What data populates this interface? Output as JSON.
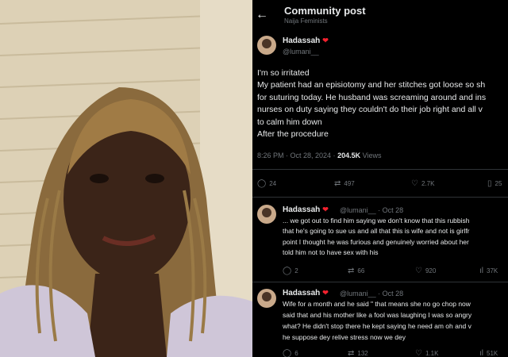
{
  "header": {
    "title": "Community post",
    "community": "Naija Feminists",
    "back_icon": "arrow-left-icon"
  },
  "main_post": {
    "name": "Hadassah",
    "handle": "@lumani__",
    "lines": [
      "I'm so irritated",
      "My patient had an episiotomy and her stitches got loose so sh",
      "for suturing today. He husband was screaming around and ins",
      "nurses on duty saying they couldn't do their job right and all v",
      "to calm him down",
      "After the procedure"
    ],
    "time": "8:26 PM · Oct 28, 2024 ·",
    "views": "204.5K",
    "views_label": "Views",
    "stats": {
      "replies": "24",
      "reposts": "497",
      "likes": "2.7K",
      "bookmarks": "25"
    }
  },
  "replies": [
    {
      "name": "Hadassah",
      "handle": "@lumani__ · Oct 28",
      "lines": [
        "... we got out to find him saying we don't know that this rubbish",
        "that he's going to sue us and all that this is wife and not is girlfr",
        "point I thought he was furious and genuinely worried about her",
        "told him not to have sex with his"
      ],
      "stats": {
        "replies": "2",
        "reposts": "66",
        "likes": "920",
        "views": "37K"
      }
    },
    {
      "name": "Hadassah",
      "handle": "@lumani__ · Oct 28",
      "lines": [
        "Wife for a month and he said \" that means she no go chop now",
        "said that and his mother like a fool was laughing I was so angry",
        "what? He didn't stop there he kept saying he need am oh and v",
        "he suppose dey relive stress now we dey"
      ],
      "stats": {
        "replies": "6",
        "reposts": "132",
        "likes": "1.1K",
        "views": "51K"
      }
    }
  ]
}
